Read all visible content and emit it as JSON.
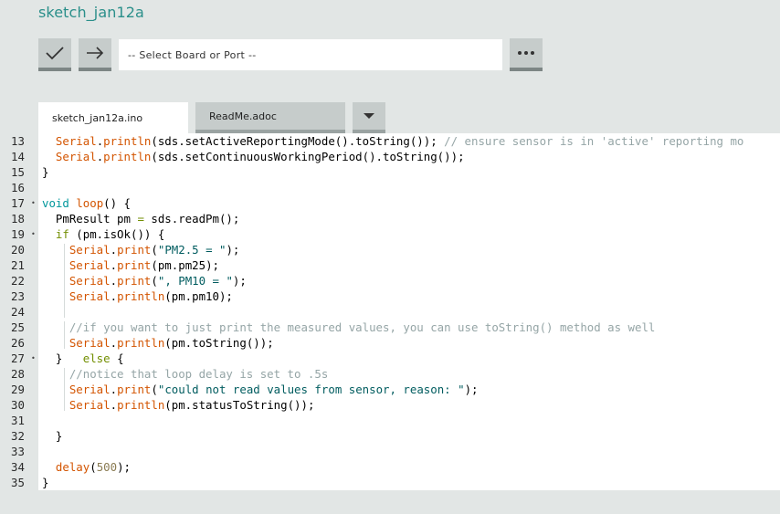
{
  "app": {
    "title": "sketch_jan12a"
  },
  "toolbar": {
    "verify_icon": "checkmark-icon",
    "upload_icon": "arrow-right-icon",
    "board_select": "-- Select Board or Port --",
    "more_icon": "ellipsis-icon"
  },
  "tabs": {
    "items": [
      {
        "label": "sketch_jan12a.ino"
      },
      {
        "label": "ReadMe.adoc"
      }
    ],
    "menu_icon": "caret-down-icon"
  },
  "editor": {
    "lines": [
      {
        "n": "13",
        "fold": ""
      },
      {
        "n": "14",
        "fold": ""
      },
      {
        "n": "15",
        "fold": ""
      },
      {
        "n": "16",
        "fold": ""
      },
      {
        "n": "17",
        "fold": "•"
      },
      {
        "n": "18",
        "fold": ""
      },
      {
        "n": "19",
        "fold": "•"
      },
      {
        "n": "20",
        "fold": ""
      },
      {
        "n": "21",
        "fold": ""
      },
      {
        "n": "22",
        "fold": ""
      },
      {
        "n": "23",
        "fold": ""
      },
      {
        "n": "24",
        "fold": ""
      },
      {
        "n": "25",
        "fold": ""
      },
      {
        "n": "26",
        "fold": ""
      },
      {
        "n": "27",
        "fold": "•"
      },
      {
        "n": "28",
        "fold": ""
      },
      {
        "n": "29",
        "fold": ""
      },
      {
        "n": "30",
        "fold": ""
      },
      {
        "n": "31",
        "fold": ""
      },
      {
        "n": "32",
        "fold": ""
      },
      {
        "n": "33",
        "fold": ""
      },
      {
        "n": "34",
        "fold": ""
      },
      {
        "n": "35",
        "fold": ""
      }
    ],
    "code": [
      [
        [
          "  ",
          ""
        ],
        [
          "Serial",
          "kw-obj"
        ],
        [
          ".",
          ""
        ],
        [
          "println",
          "kw-fn"
        ],
        [
          "(sds.setActiveReportingMode().toString()); ",
          ""
        ],
        [
          "// ensure sensor is in 'active' reporting mo",
          "cmt"
        ]
      ],
      [
        [
          "  ",
          ""
        ],
        [
          "Serial",
          "kw-obj"
        ],
        [
          ".",
          ""
        ],
        [
          "println",
          "kw-fn"
        ],
        [
          "(sds.setContinuousWorkingPeriod().toString());",
          ""
        ]
      ],
      [
        [
          "}",
          ""
        ]
      ],
      [],
      [
        [
          "void",
          "kw-type"
        ],
        [
          " ",
          ""
        ],
        [
          "loop",
          "kw-fn"
        ],
        [
          "() {",
          ""
        ]
      ],
      [
        [
          "  PmResult pm ",
          ""
        ],
        [
          "=",
          "op"
        ],
        [
          " sds.readPm();",
          ""
        ]
      ],
      [
        [
          "  ",
          ""
        ],
        [
          "if",
          "kw-ctl"
        ],
        [
          " (pm.isOk()) {",
          ""
        ]
      ],
      [
        [
          "    ",
          ""
        ],
        [
          "Serial",
          "kw-obj"
        ],
        [
          ".",
          ""
        ],
        [
          "print",
          "kw-fn"
        ],
        [
          "(",
          ""
        ],
        [
          "\"PM2.5 = \"",
          "str"
        ],
        [
          ");",
          ""
        ]
      ],
      [
        [
          "    ",
          ""
        ],
        [
          "Serial",
          "kw-obj"
        ],
        [
          ".",
          ""
        ],
        [
          "print",
          "kw-fn"
        ],
        [
          "(pm.pm25);",
          ""
        ]
      ],
      [
        [
          "    ",
          ""
        ],
        [
          "Serial",
          "kw-obj"
        ],
        [
          ".",
          ""
        ],
        [
          "print",
          "kw-fn"
        ],
        [
          "(",
          ""
        ],
        [
          "\", PM10 = \"",
          "str"
        ],
        [
          ");",
          ""
        ]
      ],
      [
        [
          "    ",
          ""
        ],
        [
          "Serial",
          "kw-obj"
        ],
        [
          ".",
          ""
        ],
        [
          "println",
          "kw-fn"
        ],
        [
          "(pm.pm10);",
          ""
        ]
      ],
      [],
      [
        [
          "    ",
          ""
        ],
        [
          "//if you want to just print the measured values, you can use toString() method as well",
          "cmt"
        ]
      ],
      [
        [
          "    ",
          ""
        ],
        [
          "Serial",
          "kw-obj"
        ],
        [
          ".",
          ""
        ],
        [
          "println",
          "kw-fn"
        ],
        [
          "(pm.toString());",
          ""
        ]
      ],
      [
        [
          "  }   ",
          ""
        ],
        [
          "else",
          "kw-ctl"
        ],
        [
          " {",
          ""
        ]
      ],
      [
        [
          "    ",
          ""
        ],
        [
          "//notice that loop delay is set to .5s",
          "cmt"
        ]
      ],
      [
        [
          "    ",
          ""
        ],
        [
          "Serial",
          "kw-obj"
        ],
        [
          ".",
          ""
        ],
        [
          "print",
          "kw-fn"
        ],
        [
          "(",
          ""
        ],
        [
          "\"could not read values from sensor, reason: \"",
          "str"
        ],
        [
          ");",
          ""
        ]
      ],
      [
        [
          "    ",
          ""
        ],
        [
          "Serial",
          "kw-obj"
        ],
        [
          ".",
          ""
        ],
        [
          "println",
          "kw-fn"
        ],
        [
          "(pm.statusToString());",
          ""
        ]
      ],
      [],
      [
        [
          "  }",
          ""
        ]
      ],
      [],
      [
        [
          "  ",
          ""
        ],
        [
          "delay",
          "kw-fn"
        ],
        [
          "(",
          ""
        ],
        [
          "500",
          "num"
        ],
        [
          ");",
          ""
        ]
      ],
      [
        [
          "}",
          ""
        ]
      ]
    ]
  }
}
